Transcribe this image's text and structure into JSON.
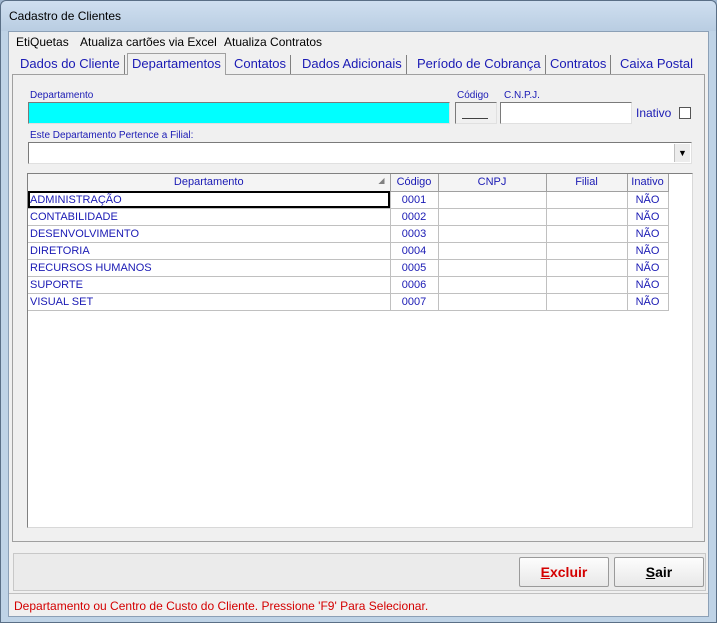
{
  "window": {
    "title": "Cadastro de Clientes"
  },
  "menu": [
    "EtiQuetas",
    "Atualiza cartões via Excel",
    "Atualiza Contratos"
  ],
  "tabs": [
    "Dados do Cliente",
    "Departamentos",
    "Contatos",
    "Dados Adicionais",
    "Período de Cobrança",
    "Contratos",
    "Caixa Postal"
  ],
  "active_tab": "Departamentos",
  "form": {
    "departamento_label": "Departamento",
    "departamento_value": "",
    "codigo_label": "Código",
    "codigo_value": "",
    "cnpj_label": "C.N.P.J.",
    "cnpj_value": "",
    "inativo_label": "Inativo",
    "inativo_checked": false,
    "filial_label": "Este Departamento Pertence a Filial:",
    "filial_value": ""
  },
  "grid": {
    "columns": [
      "Departamento",
      "Código",
      "CNPJ",
      "Filial",
      "Inativo"
    ],
    "rows": [
      [
        "ADMINISTRAÇÃO",
        "0001",
        "",
        "",
        "NÃO"
      ],
      [
        "CONTABILIDADE",
        "0002",
        "",
        "",
        "NÃO"
      ],
      [
        "DESENVOLVIMENTO",
        "0003",
        "",
        "",
        "NÃO"
      ],
      [
        "DIRETORIA",
        "0004",
        "",
        "",
        "NÃO"
      ],
      [
        "RECURSOS HUMANOS",
        "0005",
        "",
        "",
        "NÃO"
      ],
      [
        "SUPORTE",
        "0006",
        "",
        "",
        "NÃO"
      ],
      [
        "VISUAL SET",
        "0007",
        "",
        "",
        "NÃO"
      ]
    ]
  },
  "buttons": {
    "excluir_hotkey": "E",
    "excluir_rest": "xcluir",
    "sair_hotkey": "S",
    "sair_rest": "air"
  },
  "colors": {
    "excluir_text": "#d40000",
    "sair_text": "#000000",
    "input_highlight": "#00ffff",
    "label_blue": "#1a1ab4",
    "status_text": "#d40000"
  },
  "status": "Departamento ou Centro de Custo do Cliente. Pressione 'F9' Para Selecionar."
}
